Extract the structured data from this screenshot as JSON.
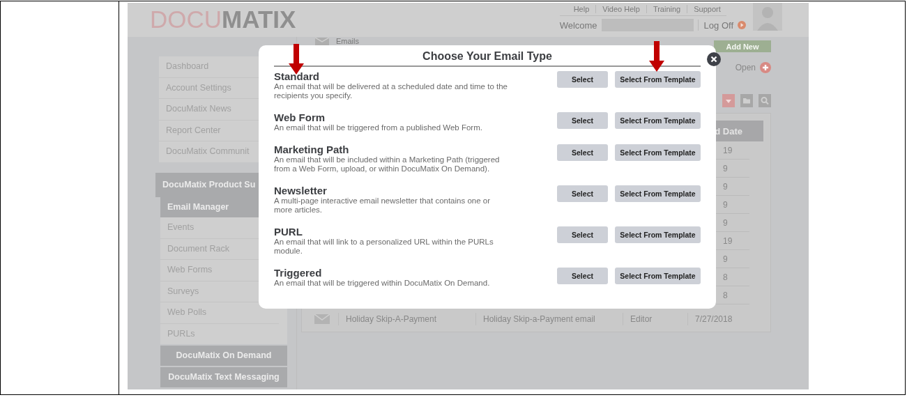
{
  "header": {
    "logo_light": "DOCU",
    "logo_bold": "MATIX",
    "links": [
      "Help",
      "Video Help",
      "Training",
      "Support"
    ],
    "welcome": "Welcome",
    "logoff": "Log Off"
  },
  "sidebar": {
    "top_items": [
      "Dashboard",
      "Account Settings",
      "DocuMatix News",
      "Report Center",
      "DocuMatix Communit"
    ],
    "product_section": "DocuMatix Product Su",
    "product_items": [
      {
        "label": "Email Manager",
        "selected": true
      },
      {
        "label": "Events",
        "selected": false
      },
      {
        "label": "Document Rack",
        "selected": false
      },
      {
        "label": "Web Forms",
        "selected": false
      },
      {
        "label": "Surveys",
        "selected": false
      },
      {
        "label": "Web Polls",
        "selected": false
      },
      {
        "label": "PURLs",
        "selected": false
      }
    ],
    "sections": [
      "DocuMatix On Demand",
      "DocuMatix Text Messaging"
    ]
  },
  "main": {
    "heading": "Emails",
    "add_button": "Add New",
    "open_button": "Open",
    "table": {
      "header_fragment": "d Date",
      "date_fragments": [
        "19",
        "9",
        "9",
        "9",
        "9",
        "19",
        "9",
        "8",
        "8"
      ],
      "last_row": [
        "Holiday Skip-A-Payment",
        "Holiday Skip-a-Payment email",
        "Editor",
        "7/27/2018"
      ]
    }
  },
  "dialog": {
    "title": "Choose Your Email Type",
    "options": [
      {
        "name": "Standard",
        "description": "An email that will be delivered at a scheduled date and time to the recipients you specify.",
        "buttons": [
          "Select",
          "Select From Template"
        ]
      },
      {
        "name": "Web Form",
        "description": "An email that will be triggered from a published Web Form.",
        "buttons": [
          "Select",
          "Select From Template"
        ]
      },
      {
        "name": "Marketing Path",
        "description": "An email that will be included within a Marketing Path (triggered from a Web Form, upload, or within DocuMatix On Demand).",
        "buttons": [
          "Select",
          "Select From Template"
        ]
      },
      {
        "name": "Newsletter",
        "description": "A multi-page interactive email newsletter that contains one or more articles.",
        "buttons": [
          "Select",
          "Select From Template"
        ]
      },
      {
        "name": "PURL",
        "description": "An email that will link to a personalized URL within the PURLs module.",
        "buttons": [
          "Select",
          "Select From Template"
        ]
      },
      {
        "name": "Triggered",
        "description": "An email that will be triggered within DocuMatix On Demand.",
        "buttons": [
          "Select",
          "Select From Template"
        ]
      }
    ]
  }
}
